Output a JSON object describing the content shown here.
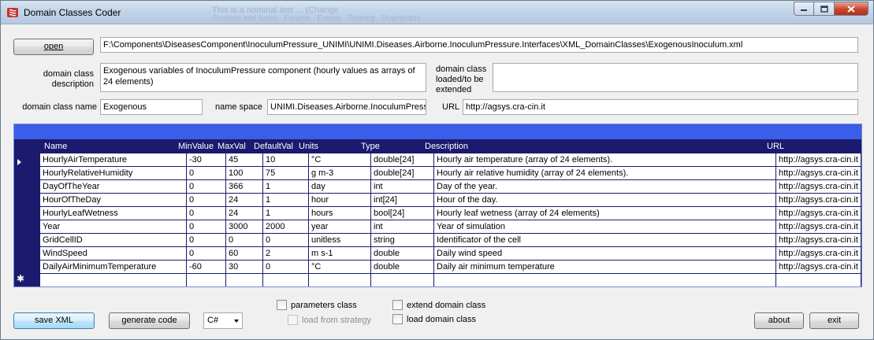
{
  "window": {
    "title": "Domain Classes Coder",
    "background_text_1": "This is a nominal test ... (Change",
    "background_text_2": "Sources and types . Forums . Events . Sharing . Downloads"
  },
  "file": {
    "open_label": "open",
    "path": "F:\\Components\\DiseasesComponent\\InoculumPressure_UNIMI\\UNIMI.Diseases.Airborne.InoculumPressure.Interfaces\\XML_DomainClasses\\ExogenousInoculum.xml"
  },
  "description": {
    "label": "domain class description",
    "value": "Exogenous variables of InoculumPressure component (hourly values as arrays of 24 elements)"
  },
  "extended": {
    "label": "domain class loaded/to be extended",
    "value": ""
  },
  "class_name": {
    "label": "domain class name",
    "value": "Exogenous"
  },
  "namespace": {
    "label": "name space",
    "value": "UNIMI.Diseases.Airborne.InoculumPressure"
  },
  "url": {
    "label": "URL",
    "value": "http://agsys.cra-cin.it"
  },
  "grid": {
    "columns": [
      "Name",
      "MinValue",
      "MaxVal",
      "DefaultVal",
      "Units",
      "Type",
      "Description",
      "URL"
    ],
    "rows": [
      [
        "HourlyAirTemperature",
        "-30",
        "45",
        "10",
        "°C",
        "double[24]",
        "Hourly air temperature (array of 24 elements).",
        "http://agsys.cra-cin.it"
      ],
      [
        "HourlyRelativeHumidity",
        "0",
        "100",
        "75",
        "g m-3",
        "double[24]",
        "Hourly air relative humidity (array of 24 elements).",
        "http://agsys.cra-cin.it"
      ],
      [
        "DayOfTheYear",
        "0",
        "366",
        "1",
        "day",
        "int",
        "Day of the year.",
        "http://agsys.cra-cin.it"
      ],
      [
        "HourOfTheDay",
        "0",
        "24",
        "1",
        "hour",
        "int[24]",
        "Hour of the day.",
        "http://agsys.cra-cin.it"
      ],
      [
        "HourlyLeafWetness",
        "0",
        "24",
        "1",
        "hours",
        "bool[24]",
        "Hourly leaf wetness (array of 24 elements)",
        "http://agsys.cra-cin.it"
      ],
      [
        "Year",
        "0",
        "3000",
        "2000",
        "year",
        "int",
        "Year of simulation",
        "http://agsys.cra-cin.it"
      ],
      [
        "GridCellID",
        "0",
        "0",
        "0",
        "unitless",
        "string",
        "Identificator of the cell",
        "http://agsys.cra-cin.it"
      ],
      [
        "WindSpeed",
        "0",
        "60",
        "2",
        "m s-1",
        "double",
        "Daily wind speed",
        "http://agsys.cra-cin.it"
      ],
      [
        "DailyAirMinimumTemperature",
        "-60",
        "30",
        "0",
        "°C",
        "double",
        "Daily air minimum temperature",
        "http://agsys.cra-cin.it"
      ],
      [
        "",
        "",
        "",
        "",
        "",
        "",
        "",
        ""
      ]
    ]
  },
  "bottom": {
    "save_xml_label": "save XML",
    "generate_code_label": "generate code",
    "language_selected": "C#",
    "parameters_class_label": "parameters class",
    "load_from_strategy_label": "load from strategy",
    "extend_domain_class_label": "extend domain class",
    "load_domain_class_label": "load domain class",
    "about_label": "about",
    "exit_label": "exit"
  }
}
